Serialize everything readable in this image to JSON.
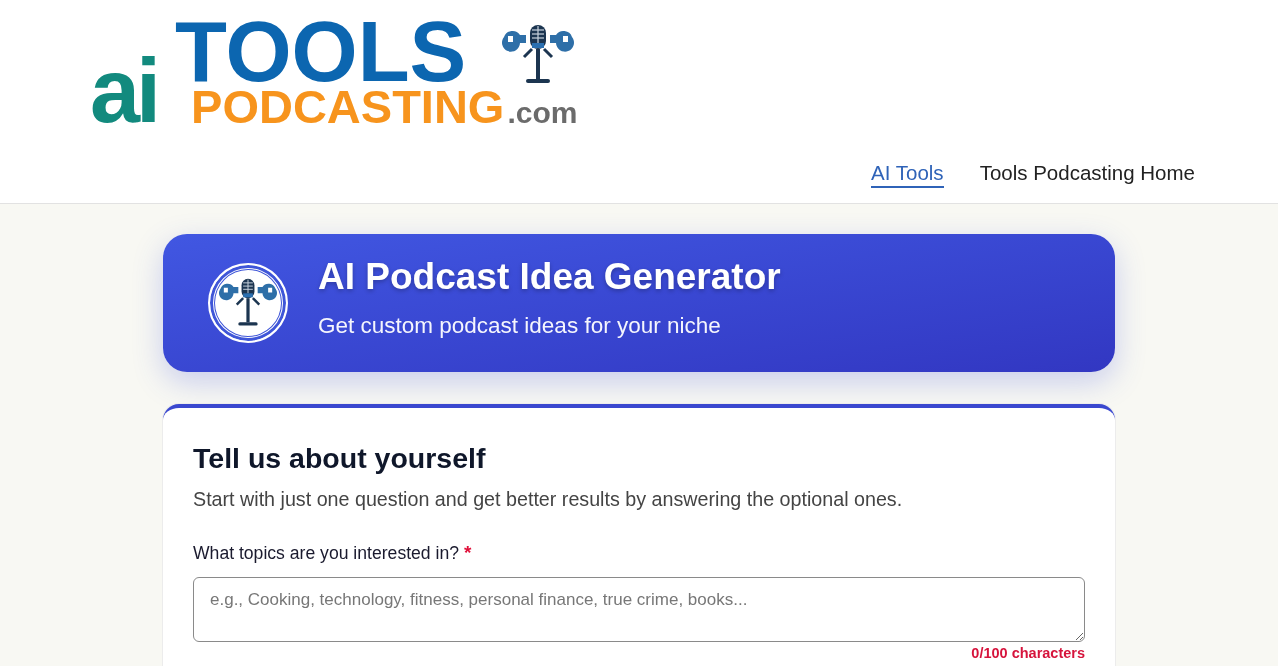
{
  "logo": {
    "prefix": "ai",
    "title": "TOOLS",
    "subtitle": "PODCASTING",
    "suffix": ".com"
  },
  "nav": [
    {
      "label": "AI Tools",
      "selected": true
    },
    {
      "label": "Tools Podcasting Home",
      "selected": false
    }
  ],
  "hero": {
    "title": "AI Podcast Idea Generator",
    "subtitle": "Get custom podcast ideas for your niche"
  },
  "form": {
    "title": "Tell us about yourself",
    "intro": "Start with just one question and get better results by answering the optional ones.",
    "fields": [
      {
        "label": "What topics are you interested in?",
        "required": true,
        "required_mark": "*",
        "placeholder": "e.g., Cooking, technology, fitness, personal finance, true crime, books...",
        "counter": "0/100 characters"
      }
    ]
  }
}
